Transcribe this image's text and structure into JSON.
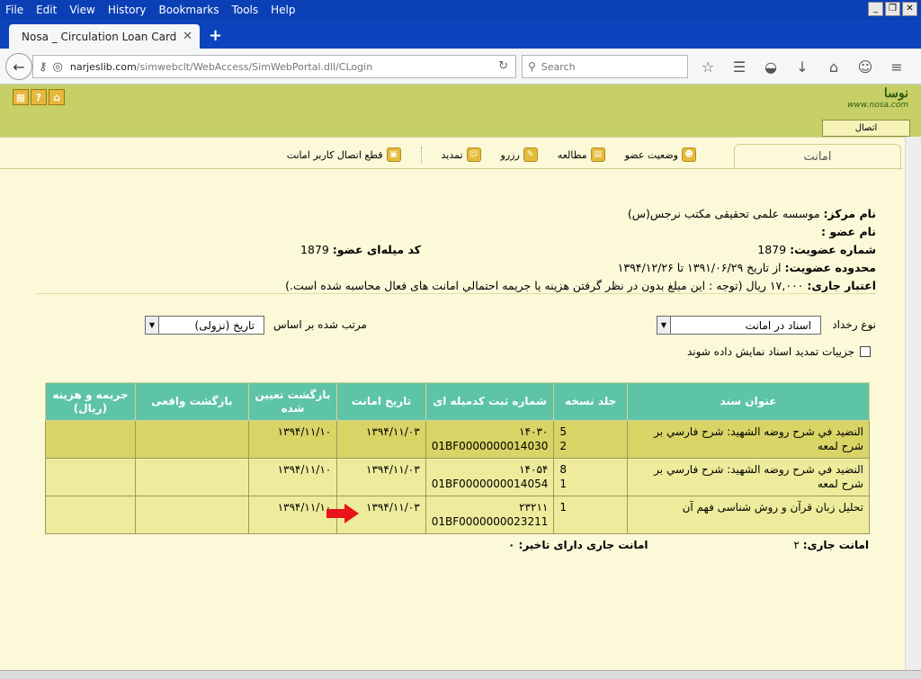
{
  "menu": [
    "File",
    "Edit",
    "View",
    "History",
    "Bookmarks",
    "Tools",
    "Help"
  ],
  "tab": {
    "title": "Nosa _ Circulation Loan Card"
  },
  "address": {
    "domain": "narjeslib.com",
    "path": "/simwebclt/WebAccess/SimWebPortal.dll/CLogin"
  },
  "search": {
    "placeholder": "Search"
  },
  "logo": {
    "fa": "نوسا",
    "en": "www.nosa.com"
  },
  "connect_button": "اتصال",
  "section_tab": "امانت",
  "toolbar": [
    {
      "label": "وضعیت عضو",
      "icon": "member-status-icon"
    },
    {
      "label": "مطالعه",
      "icon": "study-icon"
    },
    {
      "label": "رزرو",
      "icon": "reserve-icon"
    },
    {
      "label": "تمدید",
      "icon": "renew-icon"
    },
    {
      "label": "قطع اتصال کاربر امانت",
      "icon": "disconnect-icon"
    }
  ],
  "member": {
    "center_label": "نام مرکز:",
    "center_value": "موسسه علمی تحقیقی مکتب نرجس(س)",
    "name_label": "نام عضو :",
    "name_value": "",
    "membership_label": "شماره عضویت:",
    "membership_value": "1879",
    "barcode_label": "کد میله‌ای عضو:",
    "barcode_value": "1879",
    "range_label": "محدوده عضویت:",
    "range_value": "از تاریخ ۱۳۹۱/۰۶/۲۹ تا ۱۳۹۴/۱۲/۲۶",
    "credit_label": "اعتبار جاری:",
    "credit_value": "۱۷,۰۰۰ ریال (توجه : این مبلغ بدون در نظر گرفتن هزینه یا جریمه احتمالي امانت های فعال محاسبه شده است.)"
  },
  "filters": {
    "event_label": "نوع رخداد",
    "event_value": "اسناد در امانت",
    "sort_label": "مرتب شده بر اساس",
    "sort_value": "تاریخ (نزولی)",
    "details_label": "جزییات تمدید اسناد نمایش داده شوند"
  },
  "table": {
    "headers": [
      "عنوان سند",
      "جلد نسخه",
      "شماره ثبت کدمیله ای",
      "تاریخ امانت",
      "بازگشت تعیین شده",
      "بازگشت واقعی",
      "جریمه و هزینه (ریال)"
    ],
    "rows": [
      {
        "title": "النضيد في شرح روضه الشهيد: شرح فارسي بر شرح لمعه",
        "volume": "5",
        "copy": "2",
        "reg": "۱۴۰۳۰",
        "barcode": "01BF0000000014030",
        "loan_date": "۱۳۹۴/۱۱/۰۳",
        "due": "۱۳۹۴/۱۱/۱۰",
        "returned": "",
        "fine": ""
      },
      {
        "title": "النضيد في شرح روضه الشهيد: شرح فارسي بر شرح لمعه",
        "volume": "8",
        "copy": "1",
        "reg": "۱۴۰۵۴",
        "barcode": "01BF0000000014054",
        "loan_date": "۱۳۹۴/۱۱/۰۳",
        "due": "۱۳۹۴/۱۱/۱۰",
        "returned": "",
        "fine": ""
      },
      {
        "title": "تحلیل زبان قرآن و روش شناسی فهم آن",
        "volume": "",
        "copy": "1",
        "reg": "۲۳۲۱۱",
        "barcode": "01BF0000000023211",
        "loan_date": "۱۳۹۴/۱۱/۰۳",
        "due": "۱۳۹۴/۱۱/۱۰",
        "returned": "",
        "fine": ""
      }
    ]
  },
  "summary": {
    "current_label": "امانت جاری:",
    "current_value": "۲",
    "overdue_label": "امانت جاری دارای تاخیر:",
    "overdue_value": "۰"
  },
  "colors": {
    "titlebar": "#0a3fb6",
    "header_green": "#c6d066",
    "table_header": "#5ec4a7",
    "row_dark": "#d8d466",
    "row_light": "#eeec9c",
    "arrow": "#e8141b"
  }
}
